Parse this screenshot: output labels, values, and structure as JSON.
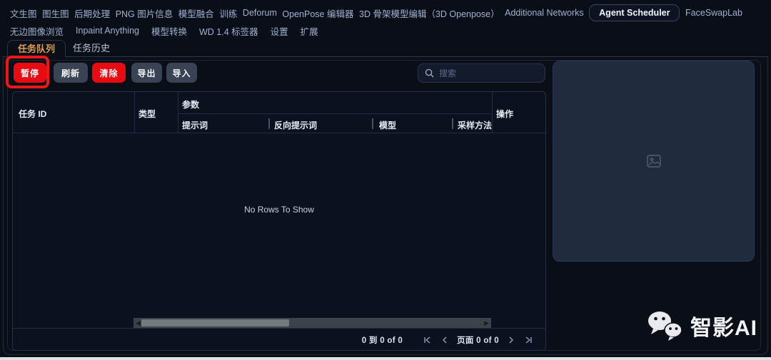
{
  "header": {
    "tabs_row1": [
      "文生图",
      "图生图",
      "后期处理",
      "PNG 图片信息",
      "模型融合",
      "训练",
      "Deforum",
      "OpenPose 编辑器",
      "3D 骨架模型编辑（3D Openpose）",
      "Additional Networks",
      "Agent Scheduler",
      "FaceSwapLab"
    ],
    "tabs_row2": [
      "无边图像浏览",
      "Inpaint Anything",
      "模型转换",
      "WD 1.4 标签器",
      "设置",
      "扩展"
    ],
    "active_tab": "Agent Scheduler"
  },
  "scheduler": {
    "tabs": {
      "queue": "任务队列",
      "history": "任务历史"
    },
    "active_tab": "任务队列",
    "toolbar": {
      "pause": "暂停",
      "refresh": "刷新",
      "clear": "清除",
      "export": "导出",
      "import": "导入",
      "search_placeholder": "搜索",
      "search_value": ""
    },
    "table": {
      "col_task_id": "任务 ID",
      "col_type": "类型",
      "col_params": "参数",
      "col_actions": "操作",
      "sub_columns": [
        "提示词",
        "反向提示词",
        "模型",
        "采样方法"
      ],
      "rows": [],
      "empty_text": "No Rows To Show"
    },
    "pagination": {
      "summary": "0 到 0 of 0",
      "page_label": "页面 0 of 0"
    }
  },
  "preview": {
    "icon": "image-placeholder"
  },
  "watermark": {
    "brand": "智影AI",
    "icon": "wechat-logo"
  },
  "icons": {
    "search": "magnifier",
    "scroll_left": "left-arrow",
    "scroll_right": "right-arrow",
    "pager": [
      "first-page",
      "previous-page",
      "next-page",
      "last-page"
    ]
  },
  "colors": {
    "page_bg": "#0a0e17",
    "accent_red": "#e80c12",
    "annotation_red": "#f01616",
    "active_subtab_text": "#dd9e4f",
    "button_gray": "#3a4353",
    "preview_panel_bg": "#202b3d"
  }
}
